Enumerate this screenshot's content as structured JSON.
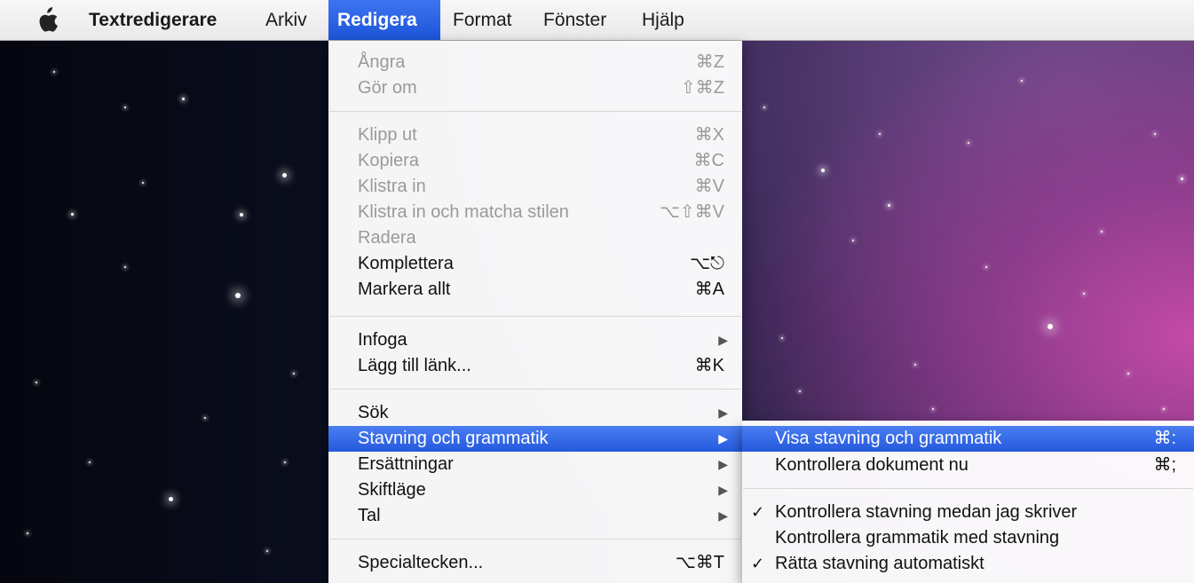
{
  "menubar": {
    "apple_icon": "apple-logo",
    "app_name": "Textredigerare",
    "items": [
      "Arkiv",
      "Redigera",
      "Format",
      "Fönster",
      "Hjälp"
    ],
    "active_item": "Redigera"
  },
  "edit_menu": {
    "items": [
      {
        "label": "Ångra",
        "shortcut": "⌘Z",
        "disabled": true
      },
      {
        "label": "Gör om",
        "shortcut": "⇧⌘Z",
        "disabled": true
      },
      {
        "label": "Klipp ut",
        "shortcut": "⌘X",
        "disabled": true
      },
      {
        "label": "Kopiera",
        "shortcut": "⌘C",
        "disabled": true
      },
      {
        "label": "Klistra in",
        "shortcut": "⌘V",
        "disabled": true
      },
      {
        "label": "Klistra in och matcha stilen",
        "shortcut": "⌥⇧⌘V",
        "disabled": true
      },
      {
        "label": "Radera",
        "shortcut": "",
        "disabled": true
      },
      {
        "label": "Komplettera",
        "shortcut": "⌥⎋",
        "disabled": false
      },
      {
        "label": "Markera allt",
        "shortcut": "⌘A",
        "disabled": false
      },
      {
        "label": "Infoga",
        "submenu": true
      },
      {
        "label": "Lägg till länk...",
        "shortcut": "⌘K",
        "disabled": false
      },
      {
        "label": "Sök",
        "submenu": true
      },
      {
        "label": "Stavning och grammatik",
        "submenu": true,
        "highlighted": true
      },
      {
        "label": "Ersättningar",
        "submenu": true
      },
      {
        "label": "Skiftläge",
        "submenu": true
      },
      {
        "label": "Tal",
        "submenu": true
      },
      {
        "label": "Specialtecken...",
        "shortcut": "⌥⌘T",
        "disabled": false
      }
    ],
    "submenu_arrow": "▶"
  },
  "spelling_submenu": {
    "items": [
      {
        "label": "Visa stavning och grammatik",
        "shortcut": "⌘:",
        "highlighted": true
      },
      {
        "label": "Kontrollera dokument nu",
        "shortcut": "⌘;"
      },
      {
        "label": "Kontrollera stavning medan jag skriver",
        "checked": true
      },
      {
        "label": "Kontrollera grammatik med stavning",
        "checked": false
      },
      {
        "label": "Rätta stavning automatiskt",
        "checked": true
      }
    ],
    "check_glyph": "✓"
  },
  "colors": {
    "menu_highlight": "#2a5fe0",
    "disabled_text": "#9a9a9a"
  }
}
